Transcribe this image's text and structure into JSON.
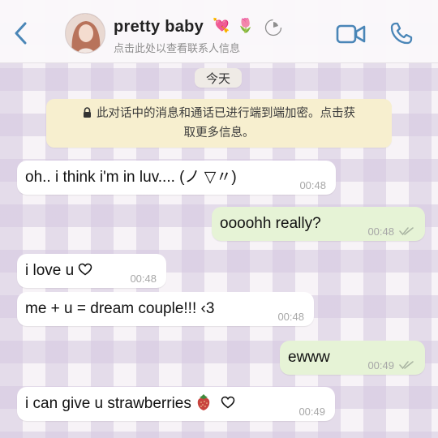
{
  "header": {
    "contact_name": "pretty baby",
    "name_emojis": [
      "💘",
      "🌷"
    ],
    "subtitle": "点击此处以查看联系人信息",
    "icons": [
      "chevron-left-icon",
      "video-camera-icon",
      "phone-icon",
      "disappearing-ring-icon"
    ]
  },
  "date_divider": "今天",
  "encryption_notice": {
    "line1": "此对话中的消息和通话已进行端到端加密。点击获",
    "line2": "取更多信息。"
  },
  "messages": [
    {
      "direction": "in",
      "text": "oh.. i think i'm in luv.... (ノ ▽〃)",
      "time": "00:48"
    },
    {
      "direction": "out",
      "text": "oooohh really?",
      "time": "00:48",
      "status": "read"
    },
    {
      "direction": "in",
      "text": "i love u",
      "icon": "heart-outline-icon",
      "time": "00:48"
    },
    {
      "direction": "in",
      "text": "me + u = dream couple!!! ‹3",
      "time": "00:48"
    },
    {
      "direction": "out",
      "text": "ewww",
      "time": "00:49",
      "status": "read"
    },
    {
      "direction": "in",
      "text": "i can give u strawberries",
      "icons": [
        "strawberry-icon",
        "heart-outline-icon"
      ],
      "time": "00:49"
    }
  ],
  "colors": {
    "incoming_bubble": "#ffffff",
    "outgoing_bubble": "#e6f3d6",
    "accent_blue": "#4a86b7",
    "notice_bg": "#f7efcf",
    "wallpaper_check": "#d6c8e0"
  }
}
